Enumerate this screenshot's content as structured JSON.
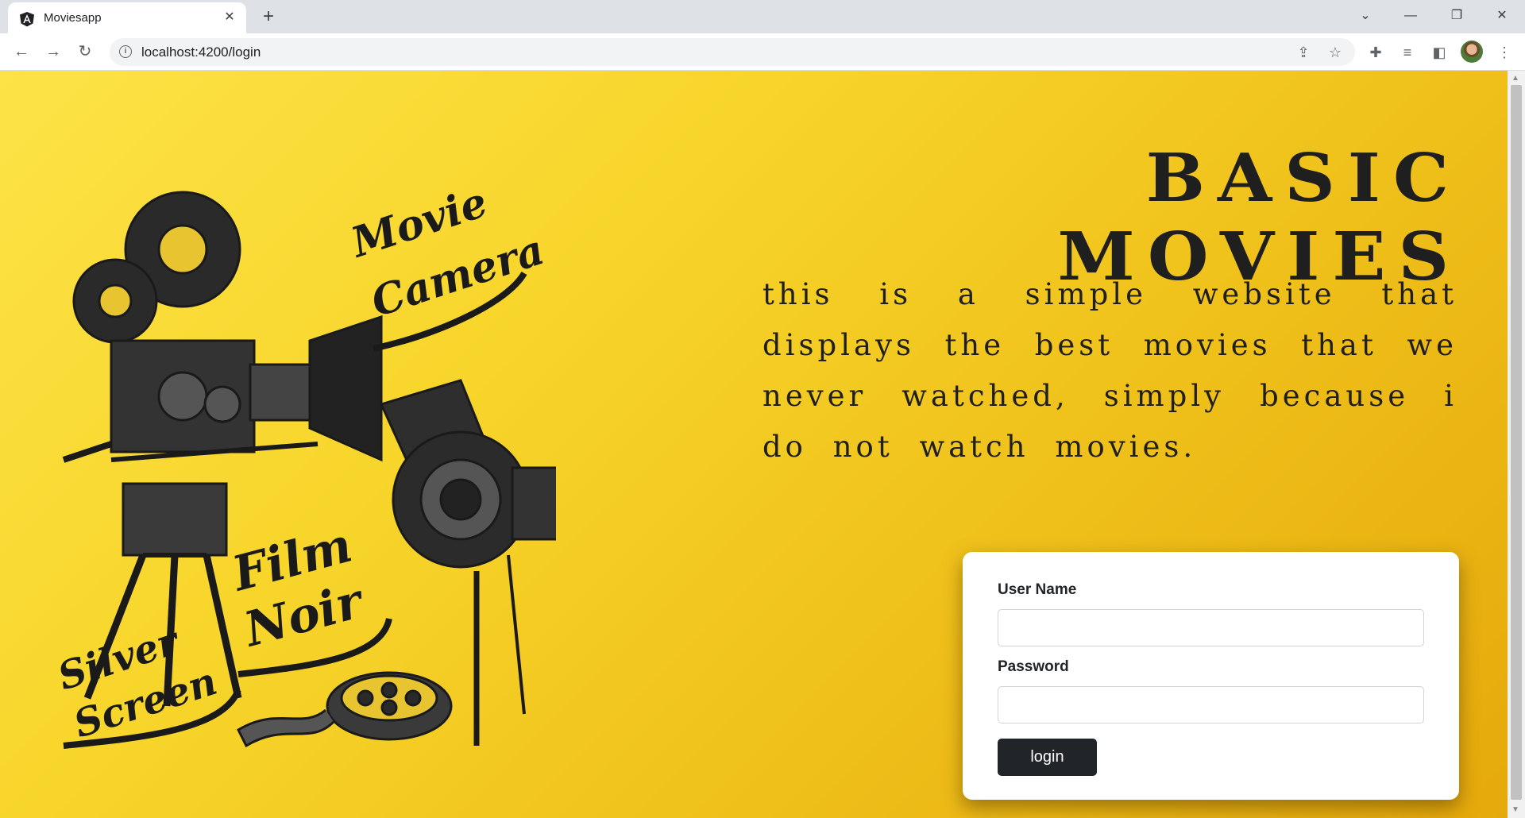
{
  "browser": {
    "tab_title": "Moviesapp",
    "url": "localhost:4200/login"
  },
  "page": {
    "title": "BASIC MOVIES",
    "description": "this is a simple website that displays the best movies that we never watched, simply because i do not watch movies.",
    "illustration": {
      "caption_movie_1": "Movie",
      "caption_movie_2": "Camera",
      "caption_film_1": "Film",
      "caption_film_2": "Noir",
      "caption_silver_1": "Silver",
      "caption_silver_2": "Screen"
    }
  },
  "login_form": {
    "username_label": "User Name",
    "username_value": "",
    "password_label": "Password",
    "password_value": "",
    "submit_label": "login"
  },
  "colors": {
    "background_start": "#fde347",
    "background_end": "#e5a90b",
    "button": "#212529",
    "text_dark": "#1f1f1f"
  }
}
